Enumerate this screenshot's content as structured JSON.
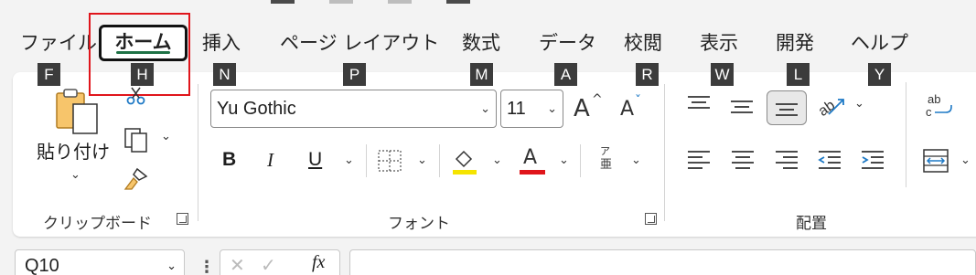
{
  "tabs": [
    {
      "label": "ファイル",
      "key": "F"
    },
    {
      "label": "ホーム",
      "key": "H",
      "active": true
    },
    {
      "label": "挿入",
      "key": "N"
    },
    {
      "label": "ページ レイアウト",
      "key": "P"
    },
    {
      "label": "数式",
      "key": "M"
    },
    {
      "label": "データ",
      "key": "A"
    },
    {
      "label": "校閲",
      "key": "R"
    },
    {
      "label": "表示",
      "key": "W"
    },
    {
      "label": "開発",
      "key": "L"
    },
    {
      "label": "ヘルプ",
      "key": "Y"
    }
  ],
  "colors": {
    "highlight": "#e0151b",
    "active_underline": "#1e7145",
    "fill_color": "#f5e400",
    "font_color": "#e0151b",
    "accent_blue": "#1f7ac6"
  },
  "clipboard": {
    "paste_label": "貼り付け",
    "group_label": "クリップボード"
  },
  "font": {
    "font_name": "Yu Gothic",
    "font_size": "11",
    "group_label": "フォント",
    "bold": "B",
    "italic": "I",
    "underline": "U",
    "grow": "A",
    "shrink": "A",
    "color_letter": "A",
    "phonetic_top": "ア",
    "phonetic_bottom": "亜"
  },
  "alignment": {
    "group_label": "配置"
  },
  "formula_bar": {
    "name_box": "Q10",
    "fx": "fx"
  },
  "icons": [
    "paste-icon",
    "cut-icon",
    "copy-icon",
    "format-painter-icon",
    "grow-font-icon",
    "shrink-font-icon",
    "borders-icon",
    "fill-color-icon",
    "font-color-icon",
    "phonetic-icon",
    "align-top-icon",
    "align-middle-icon",
    "align-bottom-icon",
    "orientation-icon",
    "wrap-text-icon",
    "align-left-icon",
    "align-center-icon",
    "align-right-icon",
    "decrease-indent-icon",
    "increase-indent-icon",
    "merge-center-icon",
    "fx-icon",
    "cancel-icon",
    "enter-icon"
  ]
}
